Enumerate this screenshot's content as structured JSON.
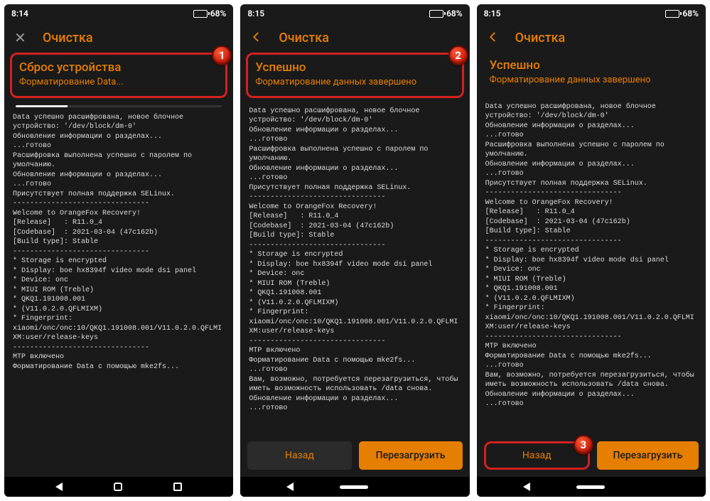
{
  "screens": [
    {
      "time": "8:14",
      "battery_pct": "68%",
      "header": {
        "icon": "close",
        "title": "Очистка"
      },
      "banner": {
        "title": "Сброс устройства",
        "subtitle": "Форматирование Data...",
        "highlighted": true,
        "badge": "1",
        "show_progress": true
      },
      "console": "Data успешно расшифрована, новое блочное устройство: '/dev/block/dm-0'\nОбновление информации о разделах...\n...готово\nРасшифровка выполнена успешно с паролем по умолчанию.\nОбновление информации о разделах...\n...готово\nПрисутствует полная поддержка SELinux.\n--------------------------------\nWelcome to OrangeFox Recovery!\n[Release]   : R11.0_4\n[Codebase]  : 2021-03-04 (47c162b)\n[Build type]: Stable\n--------------------------------\n* Storage is encrypted\n* Display: boe hx8394f video mode dsi panel\n* Device: onc\n* MIUI ROM (Treble)\n* QKQ1.191008.001\n* (V11.0.2.0.QFLMIXM)\n* Fingerprint: xiaomi/onc/onc:10/QKQ1.191008.001/V11.0.2.0.QFLMIXM:user/release-keys\n--------------------------------\nMTP включено\nФорматирование Data с помощью mke2fs...",
      "buttons": null,
      "nav_style": "a"
    },
    {
      "time": "8:15",
      "battery_pct": "68%",
      "header": {
        "icon": "back",
        "title": "Очистка"
      },
      "banner": {
        "title": "Успешно",
        "subtitle": "Форматирование данных завершено",
        "highlighted": true,
        "badge": "2",
        "show_progress": false
      },
      "console": "Data успешно расшифрована, новое блочное устройство: '/dev/block/dm-0'\nОбновление информации о разделах...\n...готово\nРасшифровка выполнена успешно с паролем по умолчанию.\nОбновление информации о разделах...\n...готово\nПрисутствует полная поддержка SELinux.\n--------------------------------\nWelcome to OrangeFox Recovery!\n[Release]   : R11.0_4\n[Codebase]  : 2021-03-04 (47c162b)\n[Build type]: Stable\n--------------------------------\n* Storage is encrypted\n* Display: boe hx8394f video mode dsi panel\n* Device: onc\n* MIUI ROM (Treble)\n* QKQ1.191008.001\n* (V11.0.2.0.QFLMIXM)\n* Fingerprint: xiaomi/onc/onc:10/QKQ1.191008.001/V11.0.2.0.QFLMIXM:user/release-keys\n--------------------------------\nMTP включено\nФорматирование Data с помощью mke2fs...\n...готово\nВам, возможно, потребуется перезагрузиться, чтобы иметь возможность использовать /data снова.\nОбновление информации о разделах...\n...готово",
      "buttons": {
        "secondary": "Назад",
        "primary": "Перезагрузить",
        "highlight_secondary": false
      },
      "nav_style": "b"
    },
    {
      "time": "8:15",
      "battery_pct": "68%",
      "header": {
        "icon": "back",
        "title": "Очистка"
      },
      "banner": {
        "title": "Успешно",
        "subtitle": "Форматирование данных завершено",
        "highlighted": false,
        "badge": null,
        "show_progress": false
      },
      "console": "Data успешно расшифрована, новое блочное устройство: '/dev/block/dm-0'\nОбновление информации о разделах...\n...готово\nРасшифровка выполнена успешно с паролем по умолчанию.\nОбновление информации о разделах...\n...готово\nПрисутствует полная поддержка SELinux.\n--------------------------------\nWelcome to OrangeFox Recovery!\n[Release]   : R11.0_4\n[Codebase]  : 2021-03-04 (47c162b)\n[Build type]: Stable\n--------------------------------\n* Storage is encrypted\n* Display: boe hx8394f video mode dsi panel\n* Device: onc\n* MIUI ROM (Treble)\n* QKQ1.191008.001\n* (V11.0.2.0.QFLMIXM)\n* Fingerprint: xiaomi/onc/onc:10/QKQ1.191008.001/V11.0.2.0.QFLMIXM:user/release-keys\n--------------------------------\nMTP включено\nФорматирование Data с помощью mke2fs...\n...готово\nВам, возможно, потребуется перезагрузиться, чтобы иметь возможность использовать /data снова.\nОбновление информации о разделах...\n...готово",
      "buttons": {
        "secondary": "Назад",
        "primary": "Перезагрузить",
        "highlight_secondary": true,
        "badge": "3"
      },
      "nav_style": "b"
    }
  ]
}
